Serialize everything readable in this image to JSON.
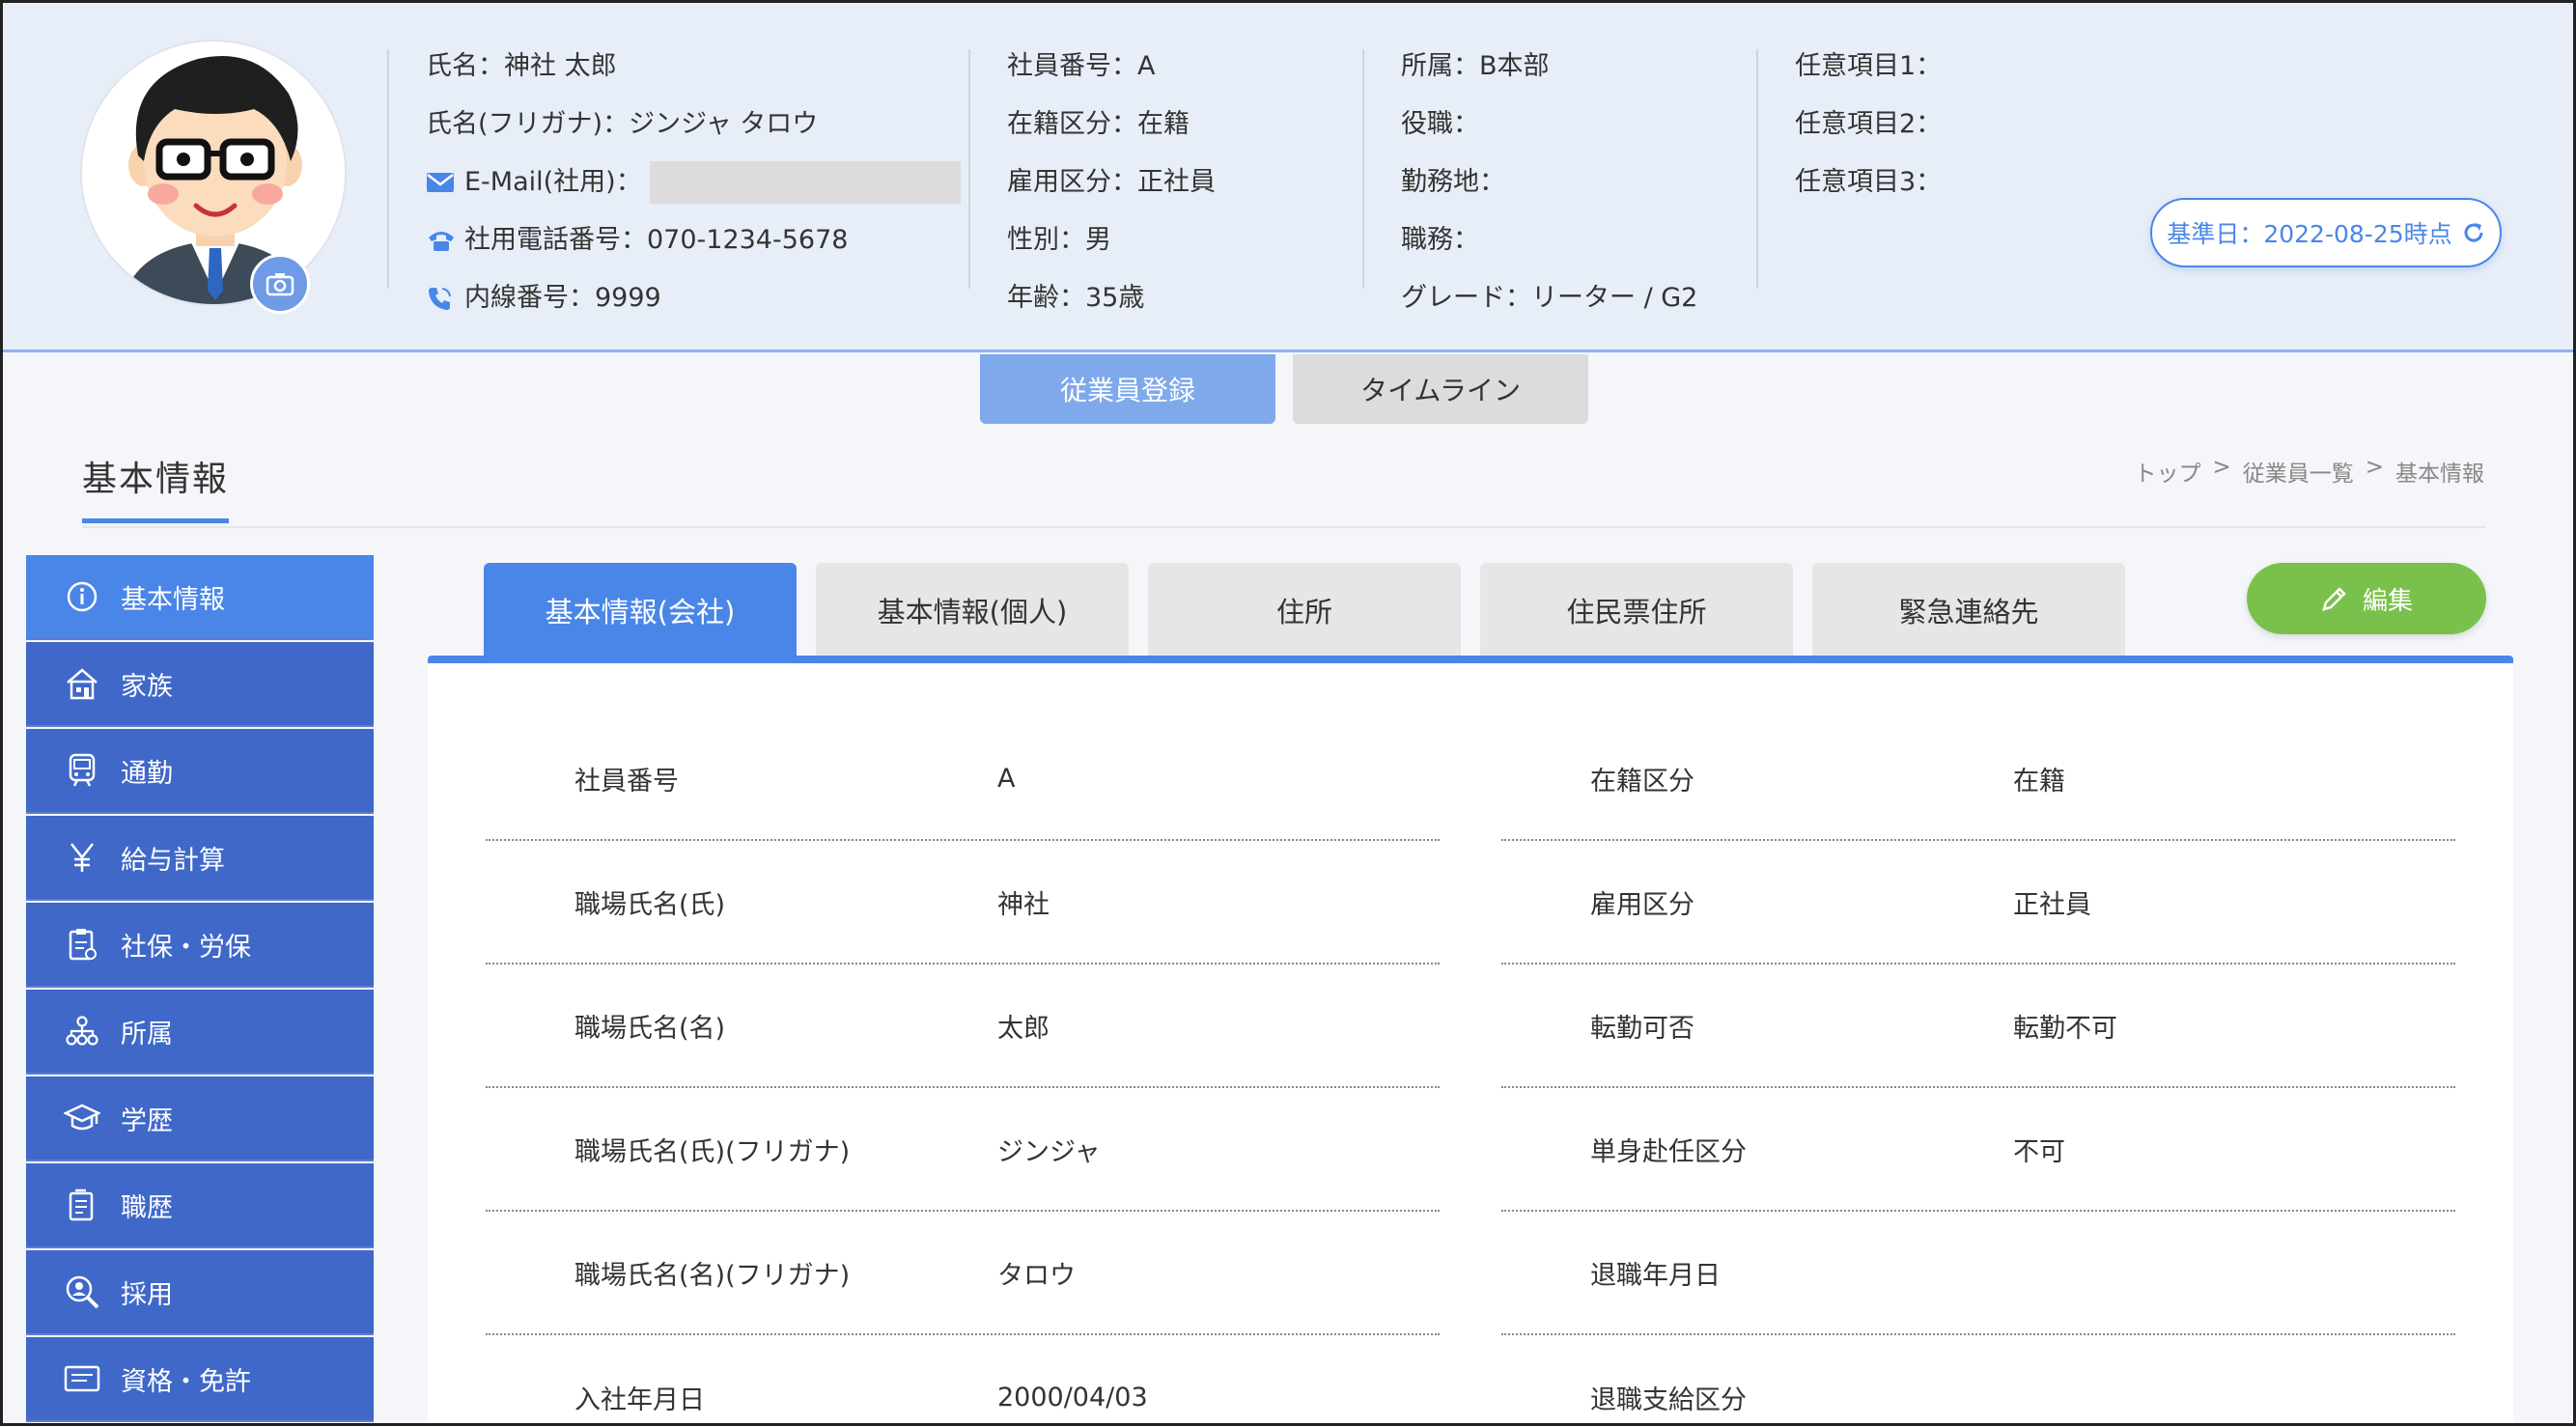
{
  "header": {
    "col1": {
      "name": "氏名：神社 太郎",
      "kana": "氏名(フリガナ)：ジンジャ タロウ",
      "email_label": "E-Mail(社用)：",
      "phone": "社用電話番号：070-1234-5678",
      "ext": "内線番号：9999"
    },
    "col2": [
      "社員番号：A",
      "在籍区分：在籍",
      "雇用区分：正社員",
      "性別：男",
      "年齢：35歳"
    ],
    "col3": [
      "所属：B本部",
      "役職：",
      "勤務地：",
      "職務：",
      "グレード：リーター / G2"
    ],
    "col4": [
      "任意項目1：",
      "任意項目2：",
      "任意項目3："
    ],
    "date_pill": "基準日：2022-08-25時点"
  },
  "top_tabs": [
    "従業員登録",
    "タイムライン"
  ],
  "page_title": "基本情報",
  "breadcrumb": [
    "トップ",
    ">",
    "従業員一覧",
    ">",
    "基本情報"
  ],
  "sidebar": [
    {
      "label": "基本情報",
      "icon": "info-icon"
    },
    {
      "label": "家族",
      "icon": "house-icon"
    },
    {
      "label": "通勤",
      "icon": "train-icon"
    },
    {
      "label": "給与計算",
      "icon": "yen-icon"
    },
    {
      "label": "社保・労保",
      "icon": "clipboard-icon"
    },
    {
      "label": "所属",
      "icon": "org-icon"
    },
    {
      "label": "学歴",
      "icon": "graduation-cap-icon"
    },
    {
      "label": "職歴",
      "icon": "document-icon"
    },
    {
      "label": "採用",
      "icon": "magnifier-person-icon"
    },
    {
      "label": "資格・免許",
      "icon": "certificate-icon"
    }
  ],
  "content_tabs": [
    "基本情報(会社)",
    "基本情報(個人)",
    "住所",
    "住民票住所",
    "緊急連絡先"
  ],
  "edit_label": "編集",
  "left_fields": [
    {
      "k": "社員番号",
      "v": "A"
    },
    {
      "k": "職場氏名(氏)",
      "v": "神社"
    },
    {
      "k": "職場氏名(名)",
      "v": "太郎"
    },
    {
      "k": "職場氏名(氏)(フリガナ)",
      "v": "ジンジャ"
    },
    {
      "k": "職場氏名(名)(フリガナ)",
      "v": "タロウ"
    },
    {
      "k": "入社年月日",
      "v": "2000/04/03"
    }
  ],
  "right_fields": [
    {
      "k": "在籍区分",
      "v": "在籍"
    },
    {
      "k": "雇用区分",
      "v": "正社員"
    },
    {
      "k": "転勤可否",
      "v": "転勤不可"
    },
    {
      "k": "単身赴任区分",
      "v": "不可"
    },
    {
      "k": "退職年月日",
      "v": ""
    },
    {
      "k": "退職支給区分",
      "v": ""
    }
  ],
  "colors": {
    "accent": "#4a86e8",
    "sidebar": "#3f68c8",
    "edit": "#7ac14c"
  }
}
